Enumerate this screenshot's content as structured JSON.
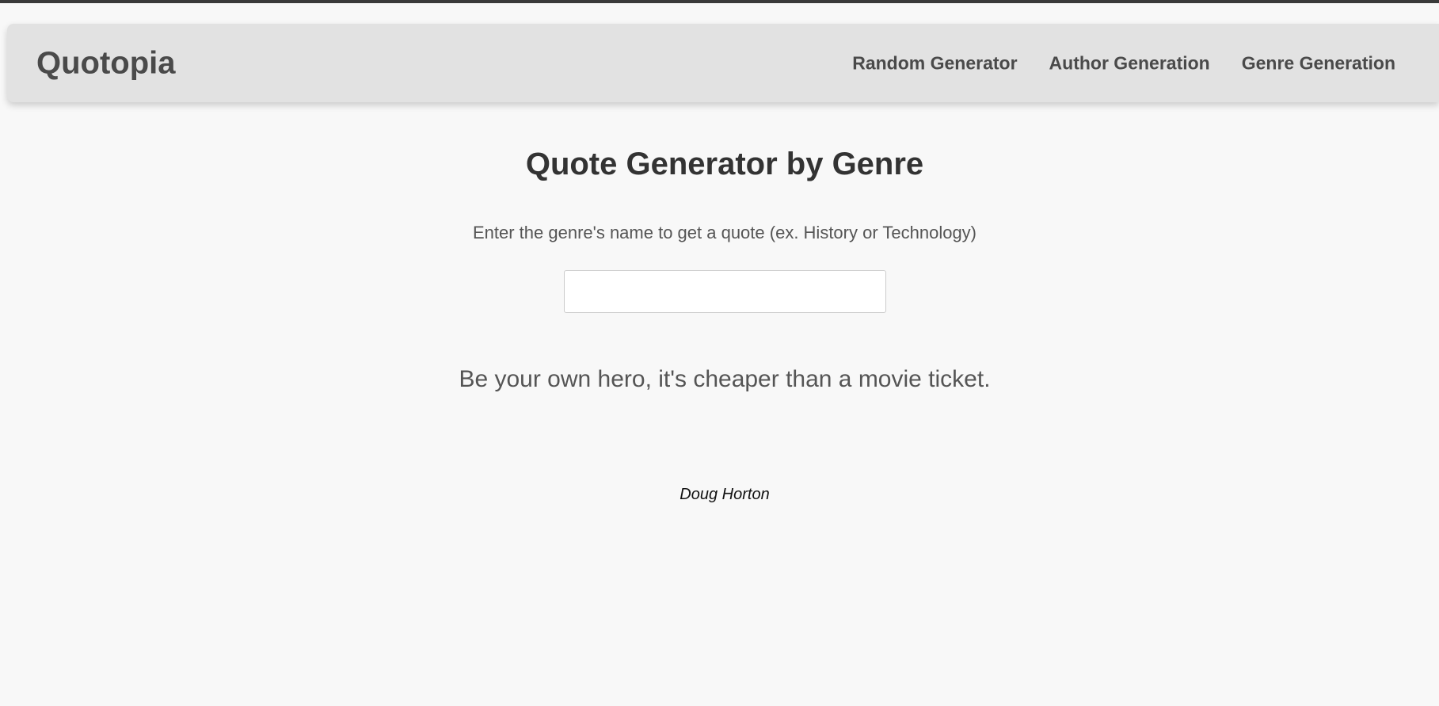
{
  "navbar": {
    "brand": "Quotopia",
    "links": [
      {
        "label": "Random Generator"
      },
      {
        "label": "Author Generation"
      },
      {
        "label": "Genre Generation"
      }
    ]
  },
  "main": {
    "title": "Quote Generator by Genre",
    "instructions": "Enter the genre's name to get a quote (ex. History or Technology)",
    "genre_input": {
      "value": "",
      "placeholder": ""
    },
    "quote": {
      "text": "Be your own hero, it's cheaper than a movie ticket.",
      "author": "Doug Horton"
    }
  },
  "colors": {
    "page_background": "#f8f8f8",
    "navbar_background": "#e2e2e2",
    "top_strip": "#3a3a3a",
    "nav_text": "#4a4a4a",
    "title_text": "#333333",
    "body_text": "#555555"
  }
}
